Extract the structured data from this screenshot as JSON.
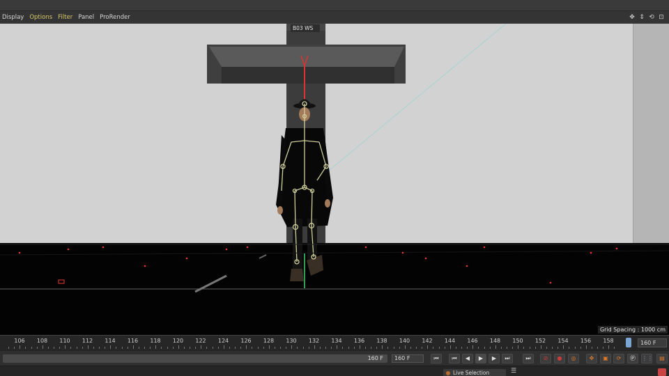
{
  "menu": {
    "items": [
      {
        "label": "Display",
        "active": false
      },
      {
        "label": "Options",
        "active": true
      },
      {
        "label": "Filter",
        "active": true
      },
      {
        "label": "Panel",
        "active": false
      },
      {
        "label": "ProRender",
        "active": false
      }
    ],
    "nav_icons": [
      "move-view-icon",
      "dolly-view-icon",
      "rotate-view-icon",
      "maximize-view-icon"
    ]
  },
  "viewport": {
    "object_label": "B03 WS",
    "grid_spacing": "Grid Spacing : 1000 cm"
  },
  "timeline": {
    "ticks": [
      "106",
      "108",
      "110",
      "112",
      "114",
      "116",
      "118",
      "120",
      "122",
      "124",
      "126",
      "128",
      "130",
      "132",
      "134",
      "136",
      "138",
      "140",
      "142",
      "144",
      "146",
      "148",
      "150",
      "152",
      "154",
      "156",
      "158"
    ],
    "end_frame": "160 F"
  },
  "transport": {
    "range_end": "160 F",
    "current_frame": "160 F"
  },
  "status": {
    "mode": "Live Selection"
  },
  "colors": {
    "accent_menu": "#d8c86a",
    "record": "#c83c3c",
    "autokey": "#e07a2a"
  }
}
